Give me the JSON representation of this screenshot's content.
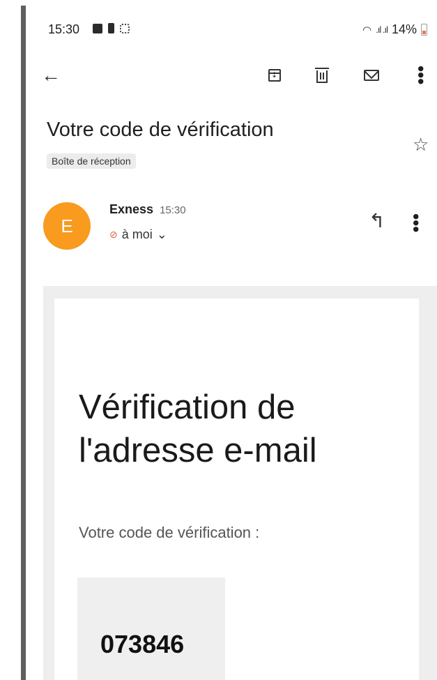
{
  "status": {
    "time": "15:30",
    "battery_text": "14%"
  },
  "toolbar": {
    "back_icon": "arrow-left-icon",
    "archive_icon": "archive-icon",
    "delete_icon": "trash-icon",
    "mark_unread_icon": "mail-icon",
    "more_icon": "more-vert-icon"
  },
  "email": {
    "subject": "Votre code de vérification",
    "label": "Boîte de réception",
    "sender_initial": "E",
    "sender_name": "Exness",
    "sent_time": "15:30",
    "recipient": "à moi",
    "recipient_chevron": "⌄"
  },
  "body": {
    "heading_line1": "Vérification de",
    "heading_line2": "l'adresse e-mail",
    "intro": "Votre code de vérification :",
    "code": "073846"
  },
  "colors": {
    "avatar": "#f89b1e",
    "label_bg": "#ececec",
    "frame_bg": "#eeeeee",
    "code_bg": "#efefef"
  }
}
